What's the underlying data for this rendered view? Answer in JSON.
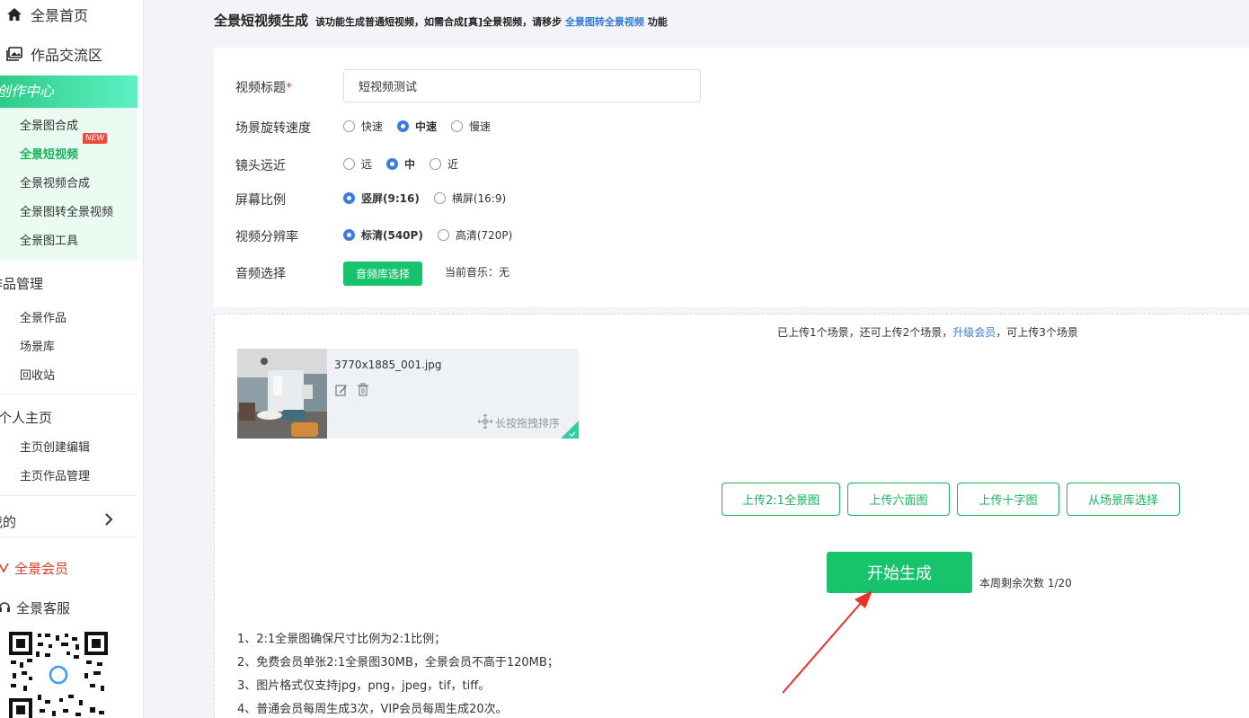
{
  "sidebar": {
    "home": "全景首页",
    "community": "作品交流区",
    "creation_center": "创作中心",
    "creation_items": [
      "全景图合成",
      "全景短视频",
      "全景视频合成",
      "全景图转全景视频",
      "全景图工具"
    ],
    "new_badge": "NEW",
    "works_section": "作品管理",
    "works_items": [
      "全景作品",
      "场景库",
      "回收站"
    ],
    "personal_section": "个人主页",
    "personal_items": [
      "主页创建编辑",
      "主页作品管理"
    ],
    "mine_section": "我的",
    "vip": "全景会员",
    "service": "全景客服",
    "accent_color": "#17c46b"
  },
  "header": {
    "title": "全景短视频生成",
    "desc_prefix": "该功能生成普通短视频，如需合成[真]全景视频，请移步",
    "desc_link": "全景图转全景视频",
    "desc_suffix": "功能"
  },
  "form": {
    "title_label": "视频标题",
    "title_required": "*",
    "title_value": "短视频测试",
    "speed_label": "场景旋转速度",
    "speed_options": [
      "快速",
      "中速",
      "慢速"
    ],
    "speed_selected": "中速",
    "distance_label": "镜头远近",
    "distance_options": [
      "远",
      "中",
      "近"
    ],
    "distance_selected": "中",
    "ratio_label": "屏幕比例",
    "ratio_options": [
      "竖屏(9:16)",
      "横屏(16:9)"
    ],
    "ratio_selected": "竖屏(9:16)",
    "resolution_label": "视频分辨率",
    "resolution_options": [
      "标清(540P)",
      "高清(720P)"
    ],
    "resolution_selected": "标清(540P)",
    "audio_label": "音频选择",
    "audio_button": "音频库选择",
    "current_music": "当前音乐：无"
  },
  "upload": {
    "quota_prefix": "已上传1个场景，还可上传2个场景，",
    "quota_link": "升级会员",
    "quota_suffix": "，可上传3个场景",
    "scene_filename": "3770x1885_001.jpg",
    "drag_hint": "长按拖拽排序",
    "buttons": [
      "上传2:1全景图",
      "上传六面图",
      "上传十字图",
      "从场景库选择"
    ],
    "start_button": "开始生成",
    "remaining": "本周剩余次数 1/20",
    "notes": [
      "1、2:1全景图确保尺寸比例为2:1比例；",
      "2、免费会员单张2:1全景图30MB，全景会员不高于120MB；",
      "3、图片格式仅支持jpg，png，jpeg，tif，tiff。",
      "4、普通会员每周生成3次，VIP会员每周生成20次。"
    ]
  }
}
